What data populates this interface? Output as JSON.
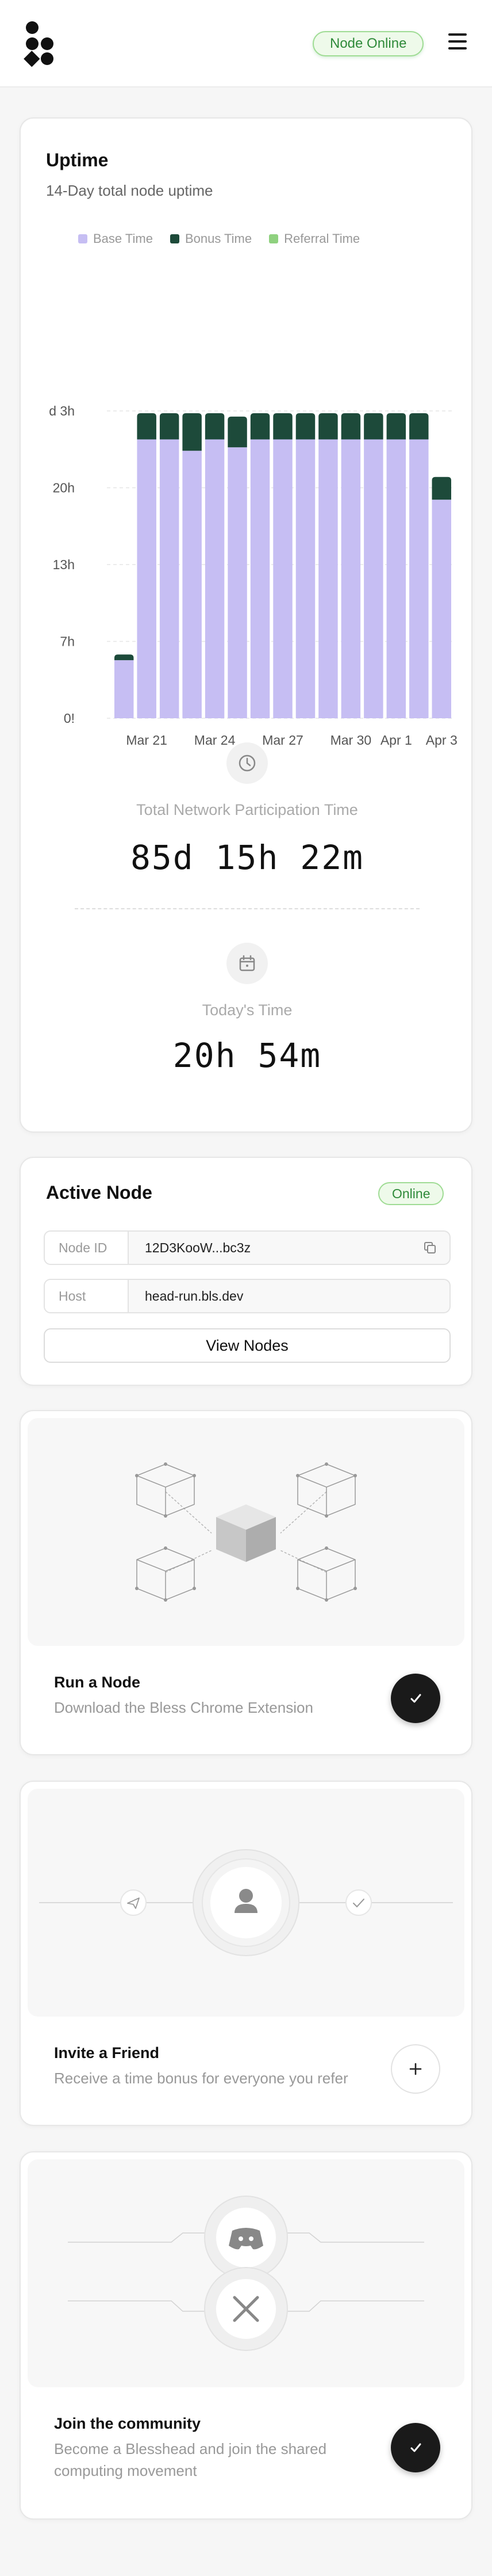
{
  "header": {
    "status": "Node Online"
  },
  "uptime": {
    "title": "Uptime",
    "subtitle": "14-Day total node uptime",
    "legend": [
      {
        "label": "Base Time",
        "color": "#c6bef3"
      },
      {
        "label": "Bonus Time",
        "color": "#1d4a3a"
      },
      {
        "label": "Referral Time",
        "color": "#8fd17f"
      }
    ],
    "total_label": "Total Network Participation Time",
    "total_value": "85d 15h 22m",
    "today_label": "Today's Time",
    "today_value": "20h 54m"
  },
  "chart_data": {
    "type": "bar",
    "stacked": true,
    "y_tick_labels": [
      "0!",
      "7h",
      "13h",
      "20h",
      "d 3h"
    ],
    "ylim_hours": [
      0,
      27
    ],
    "x_tick_labels": [
      "Mar 21",
      "Mar 24",
      "Mar 27",
      "Mar 30",
      "Apr 1",
      "Apr 3"
    ],
    "categories": [
      "Mar 20",
      "Mar 21",
      "Mar 22",
      "Mar 23",
      "Mar 24",
      "Mar 25",
      "Mar 26",
      "Mar 27",
      "Mar 28",
      "Mar 29",
      "Mar 30",
      "Mar 31",
      "Apr 1",
      "Apr 2",
      "Apr 3"
    ],
    "series": [
      {
        "name": "Base Time",
        "color": "#c6bef3",
        "values": [
          5.1,
          24.5,
          24.5,
          23.5,
          24.5,
          23.8,
          24.5,
          24.5,
          24.5,
          24.5,
          24.5,
          24.5,
          24.5,
          24.5,
          19.2
        ]
      },
      {
        "name": "Bonus Time",
        "color": "#1d4a3a",
        "values": [
          0.5,
          2.3,
          2.3,
          3.3,
          2.3,
          2.7,
          2.3,
          2.3,
          2.3,
          2.3,
          2.3,
          2.3,
          2.3,
          2.3,
          2.0
        ]
      },
      {
        "name": "Referral Time",
        "color": "#8fd17f",
        "values": [
          0,
          0,
          0,
          0,
          0,
          0,
          0,
          0,
          0,
          0,
          0,
          0,
          0,
          0,
          0
        ]
      }
    ],
    "grid": "horizontal-dashed",
    "legend_position": "top"
  },
  "active_node": {
    "title": "Active Node",
    "status": "Online",
    "node_id_label": "Node ID",
    "node_id_value": "12D3KooW...bc3z",
    "host_label": "Host",
    "host_value": "head-run.bls.dev",
    "view_button": "View Nodes"
  },
  "tasks": [
    {
      "title": "Run a Node",
      "subtitle": "Download the Bless Chrome Extension",
      "state": "completed"
    },
    {
      "title": "Invite a Friend",
      "subtitle": "Receive a time bonus for everyone you refer",
      "state": "add"
    },
    {
      "title": "Join the community",
      "subtitle": "Become a Blesshead and join the shared computing movement",
      "state": "completed"
    }
  ]
}
